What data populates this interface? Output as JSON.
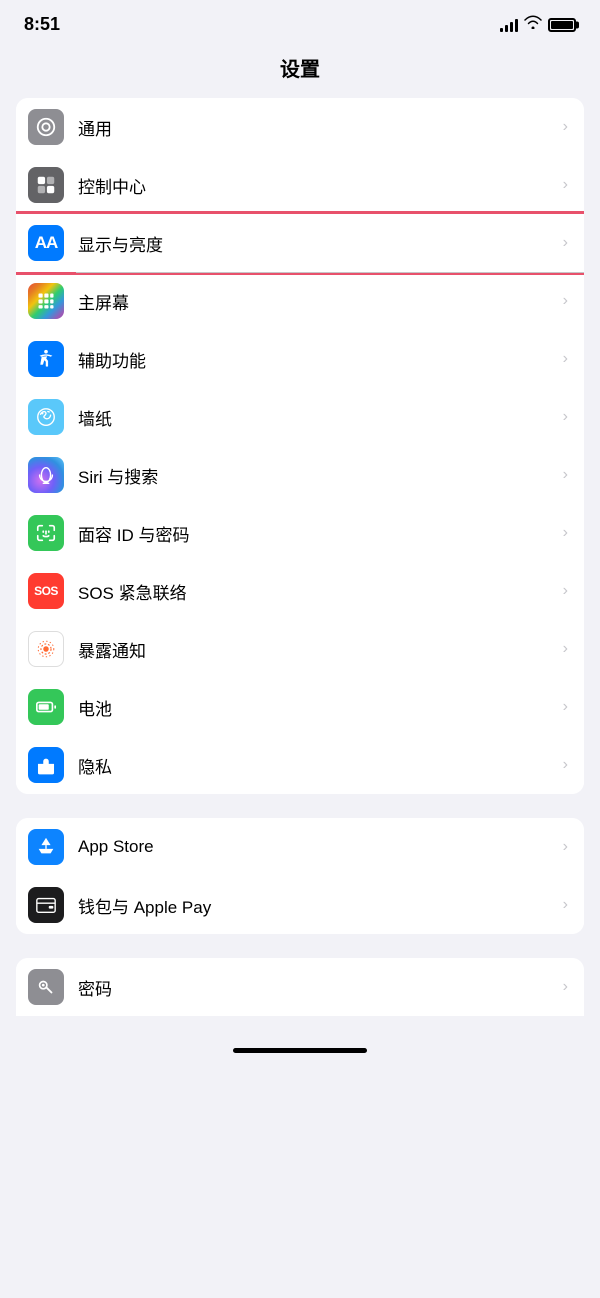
{
  "statusBar": {
    "time": "8:51"
  },
  "pageTitle": "设置",
  "section1": {
    "items": [
      {
        "id": "general",
        "label": "通用",
        "iconBg": "bg-gray",
        "iconType": "gear",
        "highlighted": false
      },
      {
        "id": "control-center",
        "label": "控制中心",
        "iconBg": "bg-gray2",
        "iconType": "toggle",
        "highlighted": false
      },
      {
        "id": "display",
        "label": "显示与亮度",
        "iconBg": "bg-blue",
        "iconType": "aa",
        "highlighted": true
      },
      {
        "id": "home-screen",
        "label": "主屏幕",
        "iconBg": "bg-colorful",
        "iconType": "grid",
        "highlighted": false
      },
      {
        "id": "accessibility",
        "label": "辅助功能",
        "iconBg": "bg-blue2",
        "iconType": "accessibility",
        "highlighted": false
      },
      {
        "id": "wallpaper",
        "label": "墙纸",
        "iconBg": "bg-floral",
        "iconType": "flower",
        "highlighted": false
      },
      {
        "id": "siri",
        "label": "Siri 与搜索",
        "iconBg": "bg-siri",
        "iconType": "siri",
        "highlighted": false
      },
      {
        "id": "faceid",
        "label": "面容 ID 与密码",
        "iconBg": "bg-green",
        "iconType": "face",
        "highlighted": false
      },
      {
        "id": "sos",
        "label": "SOS 紧急联络",
        "iconBg": "bg-red",
        "iconType": "sos",
        "highlighted": false
      },
      {
        "id": "exposure",
        "label": "暴露通知",
        "iconBg": "bg-orange-dot",
        "iconType": "exposure",
        "highlighted": false
      },
      {
        "id": "battery",
        "label": "电池",
        "iconBg": "bg-battery",
        "iconType": "battery",
        "highlighted": false
      },
      {
        "id": "privacy",
        "label": "隐私",
        "iconBg": "bg-privacy",
        "iconType": "hand",
        "highlighted": false
      }
    ]
  },
  "section2": {
    "items": [
      {
        "id": "appstore",
        "label": "App Store",
        "iconBg": "bg-appstore",
        "iconType": "appstore",
        "highlighted": false
      },
      {
        "id": "wallet",
        "label": "钱包与 Apple Pay",
        "iconBg": "bg-wallet",
        "iconType": "wallet",
        "highlighted": false
      }
    ]
  },
  "section3": {
    "items": [
      {
        "id": "password",
        "label": "密码",
        "iconBg": "bg-password",
        "iconType": "key",
        "highlighted": false
      }
    ]
  }
}
